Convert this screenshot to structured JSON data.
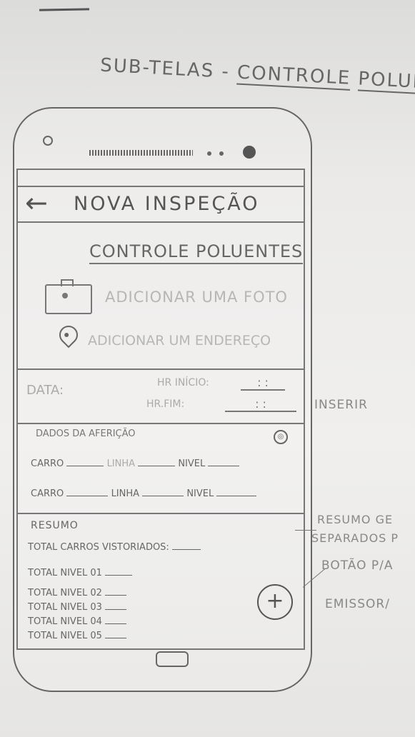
{
  "sheet": {
    "title_prefix": "SUB-TELAS -",
    "title_part1": "CONTROLE",
    "title_part2": "POLUENTES"
  },
  "appbar": {
    "back_icon": "arrow-left-icon",
    "title": "NOVA INSPEÇÃO"
  },
  "section": {
    "title": "CONTROLE POLUENTES"
  },
  "actions": {
    "photo_label": "ADICIONAR UMA FOTO",
    "location_label": "ADICIONAR UM ENDEREÇO"
  },
  "date_block": {
    "date_label": "DATA:",
    "start_label": "HR INÍCIO:",
    "start_value": ":  :",
    "end_label": "HR.FIM:",
    "end_value": ":  :"
  },
  "dados": {
    "title": "DADOS DA AFERIÇÃO",
    "rows": [
      {
        "carro": "CARRO",
        "linha": "LINHA",
        "nivel": "NIVEL"
      },
      {
        "carro": "CARRO",
        "linha": "LINHA",
        "nivel": "NIVEL"
      }
    ]
  },
  "resumo": {
    "title": "RESUMO",
    "total_label": "TOTAL CARROS VISTORIADOS:",
    "levels": [
      "TOTAL NIVEL 01",
      "TOTAL NIVEL 02",
      "TOTAL NIVEL 03",
      "TOTAL NIVEL 04",
      "TOTAL NIVEL 05"
    ]
  },
  "fab": {
    "label": "+"
  },
  "notes": {
    "inserir": "INSERIR",
    "resumo_line1": "RESUMO GE",
    "resumo_line2": "SEPARADOS P",
    "botao": "BOTÃO P/A",
    "emissor": "EMISSOR/"
  }
}
